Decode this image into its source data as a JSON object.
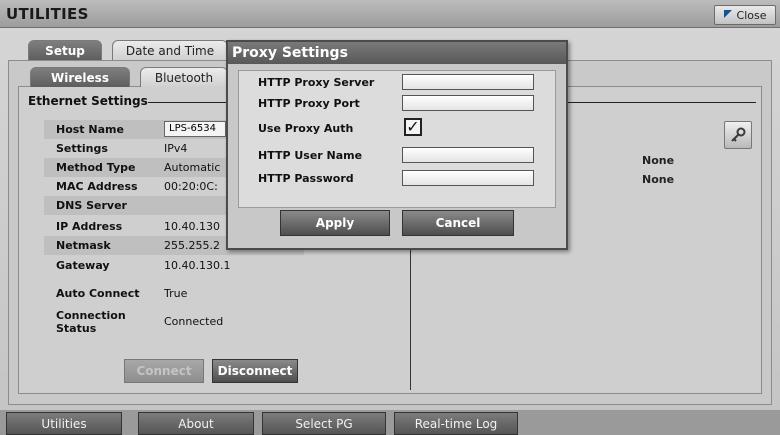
{
  "window": {
    "title": "UTILITIES",
    "close_label": "Close"
  },
  "tabs_top": [
    {
      "label": "Setup"
    },
    {
      "label": "Date and Time"
    }
  ],
  "tabs_sub": [
    {
      "label": "Wireless"
    },
    {
      "label": "Bluetooth"
    }
  ],
  "ethernet": {
    "group_title": "Ethernet Settings",
    "host_name_value": "LPS-6534",
    "rows": [
      {
        "label": "Host Name",
        "value": ""
      },
      {
        "label": "Settings",
        "value": "IPv4"
      },
      {
        "label": "Method Type",
        "value": "Automatic"
      },
      {
        "label": "MAC Address",
        "value": "00:20:0C:"
      },
      {
        "label": "DNS Server",
        "value": ""
      },
      {
        "label": "IP Address",
        "value": "10.40.130"
      },
      {
        "label": "Netmask",
        "value": "255.255.2"
      },
      {
        "label": "Gateway",
        "value": "10.40.130.1"
      },
      {
        "label": "Auto Connect",
        "value": "True"
      },
      {
        "label": "Connection Status",
        "value": "Connected"
      }
    ],
    "right_values": [
      "None",
      "None"
    ],
    "connect_label": "Connect",
    "disconnect_label": "Disconnect"
  },
  "proxy_dialog": {
    "title": "Proxy Settings",
    "fields": [
      {
        "label": "HTTP Proxy Server",
        "value": ""
      },
      {
        "label": "HTTP Proxy Port",
        "value": ""
      },
      {
        "label": "Use Proxy Auth",
        "checked": true
      },
      {
        "label": "HTTP User Name",
        "value": ""
      },
      {
        "label": "HTTP Password",
        "value": ""
      }
    ],
    "check_mark": "✓",
    "apply_label": "Apply",
    "cancel_label": "Cancel"
  },
  "bottom_nav": [
    {
      "label": "Utilities"
    },
    {
      "label": "About"
    },
    {
      "label": "Select PG"
    },
    {
      "label": "Real-time Log"
    }
  ],
  "icons": {
    "close": "close-arrow-icon",
    "key": "key-icon"
  }
}
